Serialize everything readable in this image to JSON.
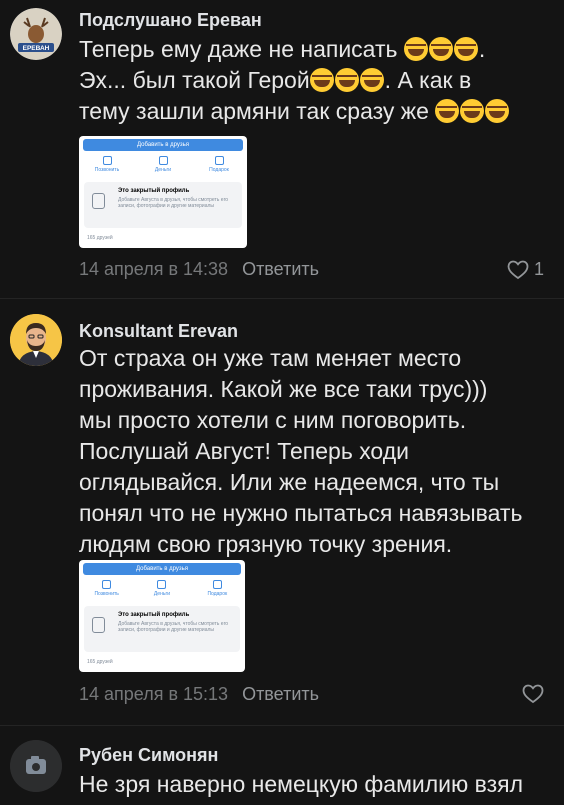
{
  "comments": [
    {
      "author": "Подслушано Ереван",
      "avatar_label": "ЕРЕВАН",
      "text_parts": [
        "Теперь ему даже не написать ",
        ".\nЭх... был такой Герой",
        ". А как в\nтему зашли армяни так сразу же "
      ],
      "emoji": "face-with-tears-of-joy-icon",
      "attachment": {
        "button": "Добавить в друзья",
        "actions": [
          "Позвонить",
          "Деньги",
          "Подарок"
        ],
        "private_title": "Это закрытый профиль",
        "private_desc": "Добавьте Августа в друзья, чтобы смотреть его записи, фотографии и другие материалы",
        "friends": "165 друзей"
      },
      "date": "14 апреля в 14:38",
      "reply": "Ответить",
      "likes": "1"
    },
    {
      "author": "Konsultant Erevan",
      "text": "От страха он уже там меняет место\nпроживания. Какой же все таки трус)))\nмы просто хотели с ним поговорить.\nПослушай Август! Теперь ходи\nоглядывайся. Или же надеемся, что ты\nпонял что не нужно пытаться навязывать\nлюдям свою грязную точку зрения.",
      "attachment": {
        "button": "Добавить в друзья",
        "actions": [
          "Позвонить",
          "Деньги",
          "Подарок"
        ],
        "private_title": "Это закрытый профиль",
        "private_desc": "Добавьте Августа в друзья, чтобы смотреть его записи, фотографии и другие материалы",
        "friends": "165 друзей"
      },
      "date": "14 апреля в 15:13",
      "reply": "Ответить"
    },
    {
      "author": "Рубен Симонян",
      "text": "Не зря наверно немецкую фамилию взял"
    }
  ],
  "colors": {
    "background": "#141414",
    "accent": "#3f8ae0",
    "emoji": "#ffcc33"
  }
}
